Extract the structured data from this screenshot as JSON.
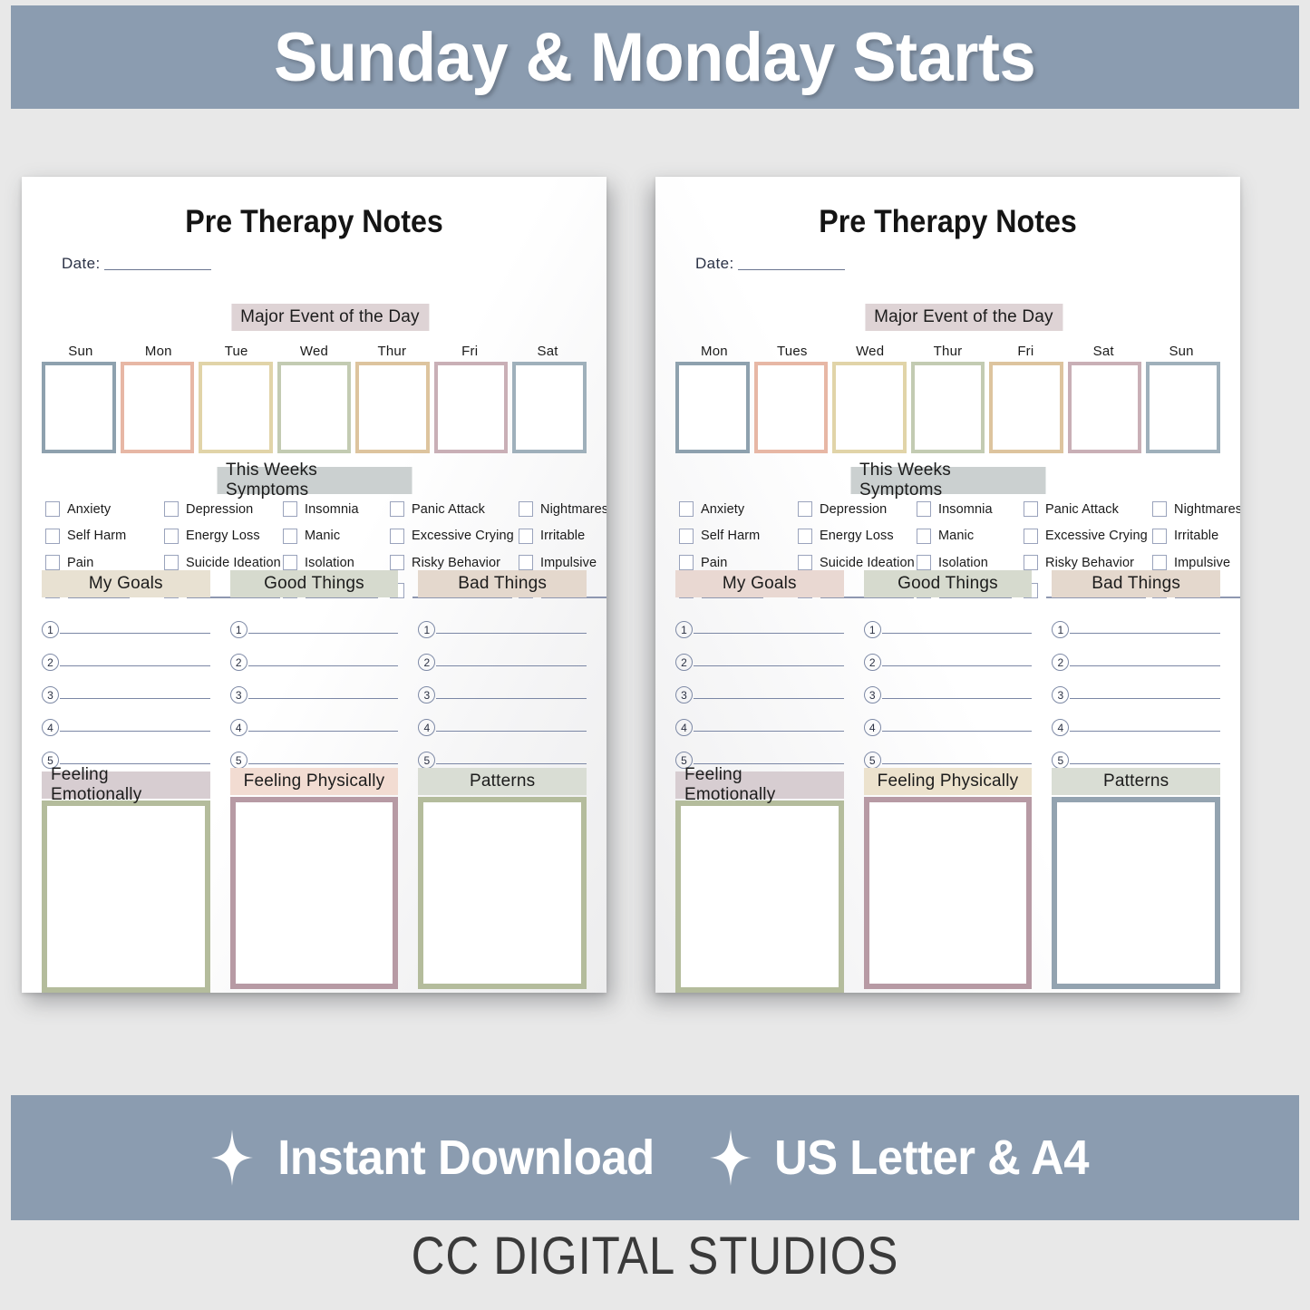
{
  "promo": {
    "top_banner": "Sunday & Monday Starts",
    "banner_color": "#8b9cb0",
    "features": [
      {
        "icon": "sparkle-icon",
        "label": "Instant Download"
      },
      {
        "icon": "sparkle-icon",
        "label": "US Letter & A4"
      }
    ],
    "brand": "CC DIGITAL STUDIOS"
  },
  "pages": [
    {
      "title": "Pre Therapy Notes",
      "date_label": "Date:",
      "date_value": "",
      "major_event_label": "Major Event of the Day",
      "major_event_chip_color": "#ded3d5",
      "days": [
        {
          "label": "Sun",
          "color": "#8ea1ae"
        },
        {
          "label": "Mon",
          "color": "#e7b7a5"
        },
        {
          "label": "Tue",
          "color": "#e1d4a8"
        },
        {
          "label": "Wed",
          "color": "#c3cbb2"
        },
        {
          "label": "Thur",
          "color": "#ddc49e"
        },
        {
          "label": "Fri",
          "color": "#c9afb6"
        },
        {
          "label": "Sat",
          "color": "#9fb0bb"
        }
      ],
      "symptoms_label": "This Weeks Symptoms",
      "symptoms_chip_color": "#cbd0d0",
      "symptoms": [
        [
          "Anxiety",
          "Depression",
          "Insomnia",
          "Panic Attack",
          "Nightmares"
        ],
        [
          "Self Harm",
          "Energy Loss",
          "Manic",
          "Excessive Crying",
          "Irritable"
        ],
        [
          "Pain",
          "Suicide Ideation",
          "Isolation",
          "Risky Behavior",
          "Impulsive"
        ]
      ],
      "blank_symptom_count": 5,
      "lists": [
        {
          "title": "My Goals",
          "chip_color": "#e8e1d2",
          "items": [
            "1",
            "2",
            "3",
            "4",
            "5"
          ]
        },
        {
          "title": "Good Things",
          "chip_color": "#d6dace",
          "items": [
            "1",
            "2",
            "3",
            "4",
            "5"
          ]
        },
        {
          "title": "Bad Things",
          "chip_color": "#e4d8cd",
          "items": [
            "1",
            "2",
            "3",
            "4",
            "5"
          ]
        }
      ],
      "feelings": [
        {
          "title": "Feeling Emotionally",
          "chip_color": "#d7cdd1",
          "border_color": "#b4bc9c"
        },
        {
          "title": "Feeling Physically",
          "chip_color": "#f2dcd2",
          "border_color": "#b79aa4"
        },
        {
          "title": "Patterns",
          "chip_color": "#d9ddd4",
          "border_color": "#b4bc9c"
        }
      ]
    },
    {
      "title": "Pre Therapy Notes",
      "date_label": "Date:",
      "date_value": "",
      "major_event_label": "Major Event of the Day",
      "major_event_chip_color": "#ded3d5",
      "days": [
        {
          "label": "Mon",
          "color": "#8ea1ae"
        },
        {
          "label": "Tues",
          "color": "#e7b7a5"
        },
        {
          "label": "Wed",
          "color": "#e1d4a8"
        },
        {
          "label": "Thur",
          "color": "#c3cbb2"
        },
        {
          "label": "Fri",
          "color": "#ddc49e"
        },
        {
          "label": "Sat",
          "color": "#c9afb6"
        },
        {
          "label": "Sun",
          "color": "#9fb0bb"
        }
      ],
      "symptoms_label": "This Weeks Symptoms",
      "symptoms_chip_color": "#cbd0d0",
      "symptoms": [
        [
          "Anxiety",
          "Depression",
          "Insomnia",
          "Panic Attack",
          "Nightmares"
        ],
        [
          "Self Harm",
          "Energy Loss",
          "Manic",
          "Excessive Crying",
          "Irritable"
        ],
        [
          "Pain",
          "Suicide Ideation",
          "Isolation",
          "Risky Behavior",
          "Impulsive"
        ]
      ],
      "blank_symptom_count": 5,
      "lists": [
        {
          "title": "My Goals",
          "chip_color": "#e9d8d2",
          "items": [
            "1",
            "2",
            "3",
            "4",
            "5"
          ]
        },
        {
          "title": "Good Things",
          "chip_color": "#d6dace",
          "items": [
            "1",
            "2",
            "3",
            "4",
            "5"
          ]
        },
        {
          "title": "Bad Things",
          "chip_color": "#e4d8cd",
          "items": [
            "1",
            "2",
            "3",
            "4",
            "5"
          ]
        }
      ],
      "feelings": [
        {
          "title": "Feeling Emotionally",
          "chip_color": "#d7cdd1",
          "border_color": "#b4bc9c"
        },
        {
          "title": "Feeling Physically",
          "chip_color": "#ece2cd",
          "border_color": "#b79aa4"
        },
        {
          "title": "Patterns",
          "chip_color": "#d9ddd4",
          "border_color": "#93a3b0"
        }
      ]
    }
  ]
}
